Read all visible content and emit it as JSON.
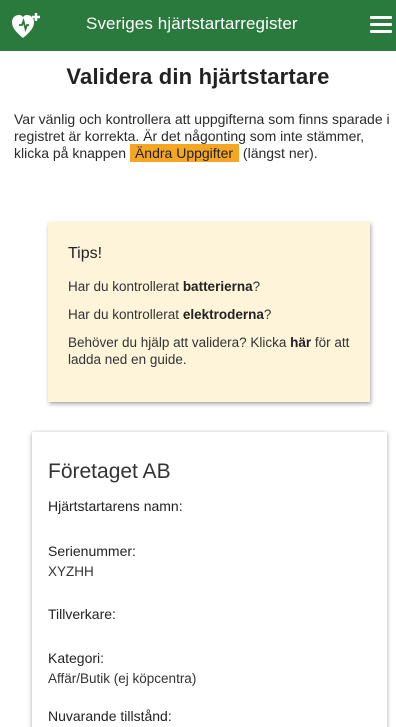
{
  "header": {
    "app_title": "Sveriges hjärtstartarregister",
    "logo_icon": "heart-defibrillator-icon",
    "menu_icon": "hamburger-menu-icon",
    "bar_color": "#2b7a3d"
  },
  "page": {
    "title": "Validera din hjärtstartare",
    "intro_text": "Var vänlig och kontrollera att uppgifterna som finns sparade i registret är korrekta. Är det någonting som inte stämmer, klicka på knappen",
    "intro_button": "Ändra Uppgifter",
    "intro_suffix": "(längst ner).",
    "button_color": "#f5a623"
  },
  "tips": {
    "title": "Tips!",
    "tip1_pre": "Har du kontrollerat ",
    "tip1_bold": "batterierna",
    "tip1_post": "?",
    "tip2_pre": "Har du kontrollerat ",
    "tip2_bold": "elektroderna",
    "tip2_post": "?",
    "tip3_pre": "Behöver du hjälp att validera? Klicka ",
    "tip3_link": "här",
    "tip3_post": " för att ladda ned en guide.",
    "background": "#fdf4d9"
  },
  "card": {
    "company": "Företaget AB",
    "fields": [
      {
        "label": "Hjärtstartarens namn:",
        "value": ""
      },
      {
        "label": "Serienummer:",
        "value": "XYZHH"
      },
      {
        "label": "Tillverkare:",
        "value": ""
      },
      {
        "label": "Kategori:",
        "value": "Affär/Butik (ej köpcentra)"
      },
      {
        "label": "Nuvarande tillstånd:",
        "value": ""
      }
    ]
  }
}
